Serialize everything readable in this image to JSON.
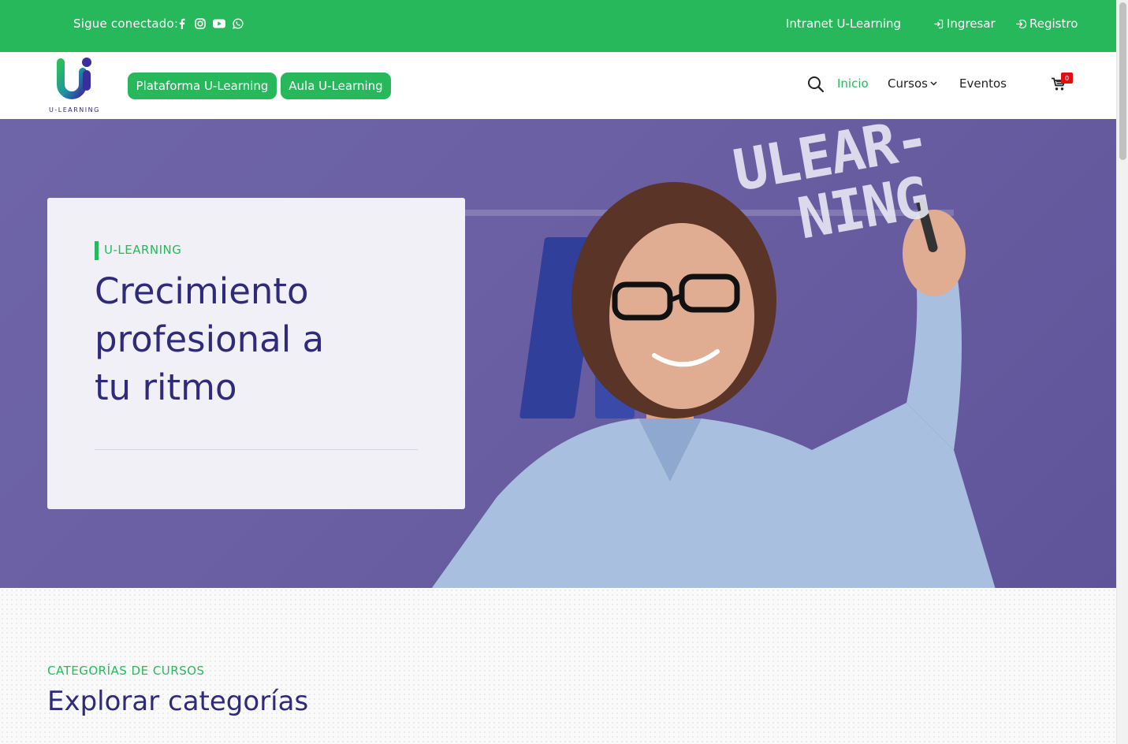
{
  "topbar": {
    "follow_label": "Sigue conectado:",
    "socials": [
      "facebook-icon",
      "instagram-icon",
      "youtube-icon",
      "whatsapp-icon"
    ],
    "intranet": "Intranet U-Learning",
    "login": "Ingresar",
    "register": "Registro"
  },
  "navbar": {
    "logo_text": "U-LEARNING",
    "pill_platform": "Plataforma U-Learning",
    "pill_classroom": "Aula U-Learning",
    "nav_home": "Inicio",
    "nav_courses": "Cursos",
    "nav_events": "Eventos",
    "cart_count": "0"
  },
  "hero": {
    "tag": "U-LEARNING",
    "title": "Crecimiento profesional a tu ritmo",
    "image_text_line1": "ULEAR-",
    "image_text_line2": "NING"
  },
  "categories": {
    "eyebrow": "CATEGORÍAS DE CURSOS",
    "title": "Explorar categorías"
  },
  "colors": {
    "brand_green": "#28b85c",
    "brand_purple": "#2f2a7a",
    "badge_red": "#e01010"
  }
}
